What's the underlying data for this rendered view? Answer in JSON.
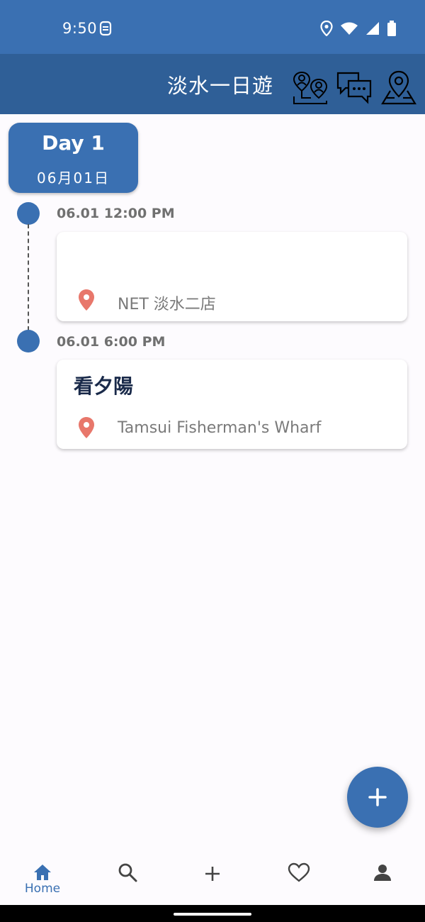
{
  "status_bar": {
    "time": "9:50",
    "icons": [
      "sim-notification-icon",
      "location-icon",
      "wifi-icon",
      "signal-icon",
      "battery-icon"
    ]
  },
  "app_bar": {
    "title": "淡水一日遊",
    "actions": [
      "members-location-icon",
      "chat-icon",
      "map-icon"
    ]
  },
  "day": {
    "title": "Day 1",
    "date": "06月01日"
  },
  "events": [
    {
      "time": "06.01 12:00 PM",
      "title": "",
      "location": "NET 淡水二店"
    },
    {
      "time": "06.01 6:00 PM",
      "title": "看夕陽",
      "location": "Tamsui Fisherman's Wharf"
    }
  ],
  "nav": {
    "items": [
      {
        "icon": "home-icon",
        "label": "Home",
        "active": true
      },
      {
        "icon": "search-icon",
        "label": "",
        "active": false
      },
      {
        "icon": "add-icon",
        "label": "",
        "active": false
      },
      {
        "icon": "heart-icon",
        "label": "",
        "active": false
      },
      {
        "icon": "person-icon",
        "label": "",
        "active": false
      }
    ]
  },
  "colors": {
    "primary": "#3a70b2",
    "app_bar": "#2f5f97",
    "pin": "#e8776b",
    "background": "#fdfbfe"
  }
}
